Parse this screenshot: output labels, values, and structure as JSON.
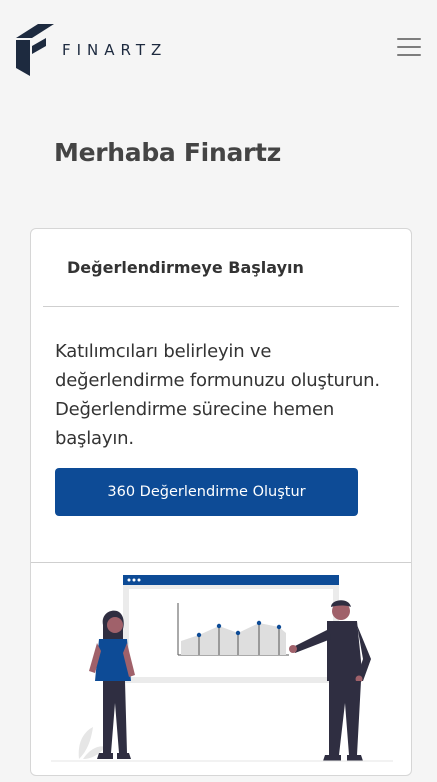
{
  "brand": {
    "name": "FINARTZ",
    "color": "#1d2a3f"
  },
  "header": {
    "menu_icon": "hamburger-menu-icon"
  },
  "greeting": "Merhaba Finartz",
  "card": {
    "title": "Değerlendirmeye Başlayın",
    "description_line1": "Katılımcıları belirleyin ve değerlendirme formunuzu oluşturun.",
    "description_line2": "Değerlendirme sürecine hemen başlayın.",
    "button_label": "360 Değerlendirme Oluştur",
    "button_color": "#0d4b96"
  },
  "illustration": {
    "icon": "presentation-chart-illustration"
  }
}
